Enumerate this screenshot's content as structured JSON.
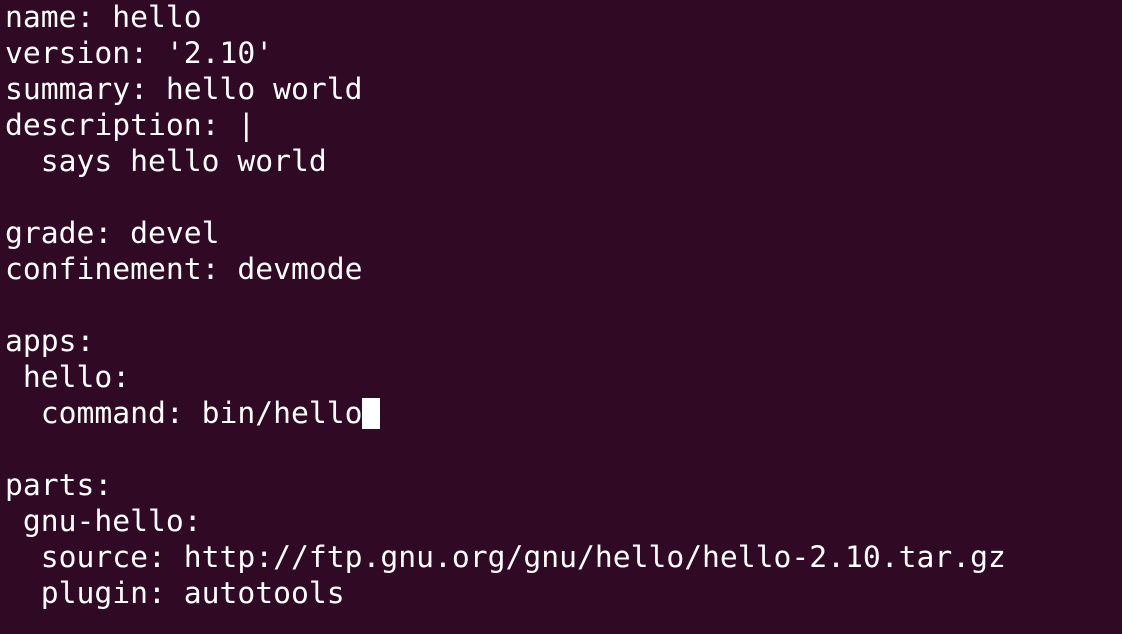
{
  "terminal": {
    "background_color": "#300a24",
    "text_color": "#ffffff",
    "lines": [
      "name: hello",
      "version: '2.10'",
      "summary: hello world",
      "description: |",
      "  says hello world",
      "",
      "grade: devel",
      "confinement: devmode",
      "",
      "apps:",
      " hello:",
      "  command: bin/hello",
      "",
      "parts:",
      " gnu-hello:",
      "  source: http://ftp.gnu.org/gnu/hello/hello-2.10.tar.gz",
      "  plugin: autotools"
    ],
    "cursor_line": 11
  }
}
